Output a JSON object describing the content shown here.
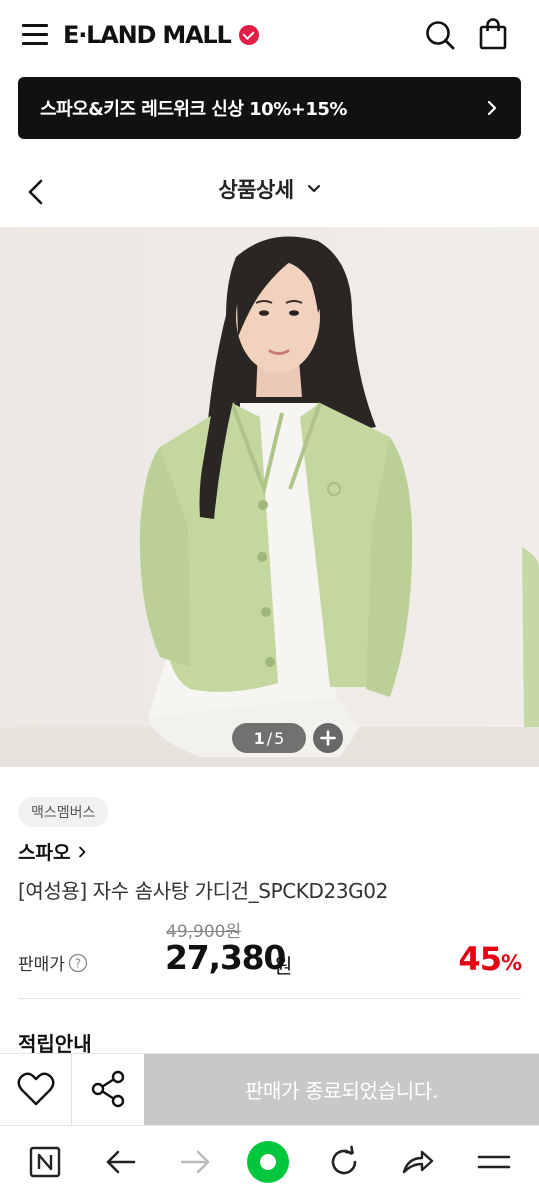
{
  "header": {
    "logo_text": "E·LAND MALL",
    "brand_color": "#e11d48"
  },
  "promo": {
    "text": "스파오&키즈 레드위크 신상 10%+15%"
  },
  "nav": {
    "title": "상품상세"
  },
  "gallery": {
    "current": "1",
    "separator": "/",
    "total": "5"
  },
  "product": {
    "badge": "맥스멤버스",
    "brand": "스파오",
    "name": "[여성용] 자수 솜사탕 가디건_SPCKD23G02",
    "original_price": "49,900원",
    "price_label": "판매가",
    "price": "27,380",
    "price_unit": "원",
    "discount_value": "45",
    "discount_unit": "%",
    "discount_color": "#e60012"
  },
  "section": {
    "points_title": "적립안내"
  },
  "actions": {
    "soldout_label": "판매가 종료되었습니다."
  },
  "browser": {
    "accent_color": "#00c73c"
  }
}
